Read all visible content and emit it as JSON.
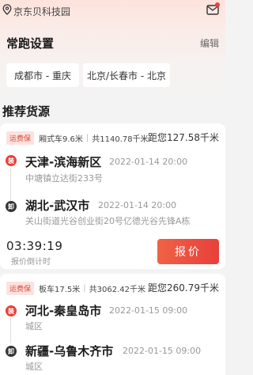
{
  "header": {
    "location": "京东贝科技园",
    "icons": {
      "location": "location-pin-icon",
      "message": "message-icon"
    }
  },
  "routes": {
    "title": "常跑设置",
    "edit_label": "编辑",
    "items": [
      "成都市 - 重庆",
      "北京/长春市 - 北京"
    ]
  },
  "recommended": {
    "title": "推荐货源",
    "cards": [
      {
        "insurance_tag": "运费保",
        "truck_type": "厢式车9.6米",
        "total": "共1140.78千米",
        "distance": "距您127.58千米",
        "load": {
          "badge": "装",
          "city": "天津-滨海新区",
          "time": "2022-01-14 20:00",
          "address": "中塘镇立达街233号"
        },
        "unload": {
          "badge": "卸",
          "city": "湖北-武汉市",
          "time": "2022-01-14 20:00",
          "address": "关山街道光谷创业街20号亿德光谷先锋A栋"
        },
        "countdown": "03:39:19",
        "countdown_label": "报价倒计时",
        "bid_label": "报价"
      },
      {
        "insurance_tag": "运费保",
        "truck_type": "板车17.5米",
        "total": "共3062.42千米",
        "distance": "距您260.79千米",
        "load": {
          "badge": "装",
          "city": "河北-秦皇岛市",
          "time": "2022-01-15 09:00",
          "address": "城区"
        },
        "unload": {
          "badge": "卸",
          "city": "新疆-乌鲁木齐市",
          "time": "2022-01-15 09:00",
          "address": "城区"
        }
      }
    ]
  },
  "colors": {
    "accent": "#e8403a",
    "tag_bg": "#fde2df"
  }
}
